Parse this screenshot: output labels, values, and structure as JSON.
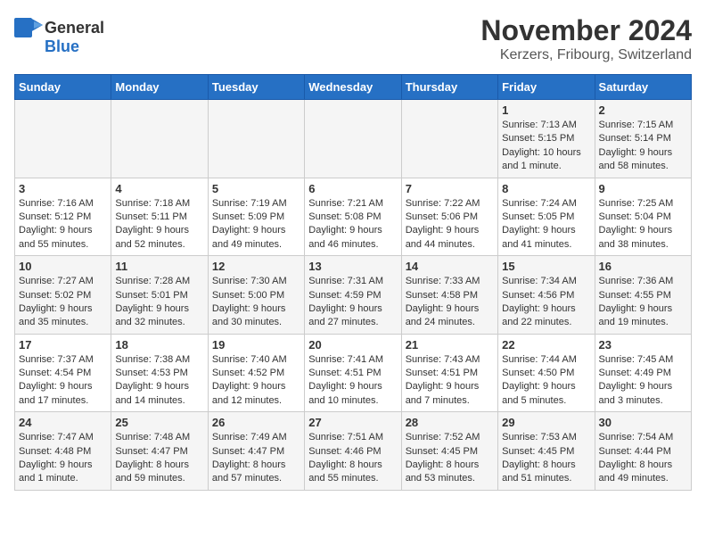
{
  "logo": {
    "general": "General",
    "blue": "Blue"
  },
  "header": {
    "month": "November 2024",
    "location": "Kerzers, Fribourg, Switzerland"
  },
  "weekdays": [
    "Sunday",
    "Monday",
    "Tuesday",
    "Wednesday",
    "Thursday",
    "Friday",
    "Saturday"
  ],
  "weeks": [
    [
      {
        "day": "",
        "info": ""
      },
      {
        "day": "",
        "info": ""
      },
      {
        "day": "",
        "info": ""
      },
      {
        "day": "",
        "info": ""
      },
      {
        "day": "",
        "info": ""
      },
      {
        "day": "1",
        "info": "Sunrise: 7:13 AM\nSunset: 5:15 PM\nDaylight: 10 hours and 1 minute."
      },
      {
        "day": "2",
        "info": "Sunrise: 7:15 AM\nSunset: 5:14 PM\nDaylight: 9 hours and 58 minutes."
      }
    ],
    [
      {
        "day": "3",
        "info": "Sunrise: 7:16 AM\nSunset: 5:12 PM\nDaylight: 9 hours and 55 minutes."
      },
      {
        "day": "4",
        "info": "Sunrise: 7:18 AM\nSunset: 5:11 PM\nDaylight: 9 hours and 52 minutes."
      },
      {
        "day": "5",
        "info": "Sunrise: 7:19 AM\nSunset: 5:09 PM\nDaylight: 9 hours and 49 minutes."
      },
      {
        "day": "6",
        "info": "Sunrise: 7:21 AM\nSunset: 5:08 PM\nDaylight: 9 hours and 46 minutes."
      },
      {
        "day": "7",
        "info": "Sunrise: 7:22 AM\nSunset: 5:06 PM\nDaylight: 9 hours and 44 minutes."
      },
      {
        "day": "8",
        "info": "Sunrise: 7:24 AM\nSunset: 5:05 PM\nDaylight: 9 hours and 41 minutes."
      },
      {
        "day": "9",
        "info": "Sunrise: 7:25 AM\nSunset: 5:04 PM\nDaylight: 9 hours and 38 minutes."
      }
    ],
    [
      {
        "day": "10",
        "info": "Sunrise: 7:27 AM\nSunset: 5:02 PM\nDaylight: 9 hours and 35 minutes."
      },
      {
        "day": "11",
        "info": "Sunrise: 7:28 AM\nSunset: 5:01 PM\nDaylight: 9 hours and 32 minutes."
      },
      {
        "day": "12",
        "info": "Sunrise: 7:30 AM\nSunset: 5:00 PM\nDaylight: 9 hours and 30 minutes."
      },
      {
        "day": "13",
        "info": "Sunrise: 7:31 AM\nSunset: 4:59 PM\nDaylight: 9 hours and 27 minutes."
      },
      {
        "day": "14",
        "info": "Sunrise: 7:33 AM\nSunset: 4:58 PM\nDaylight: 9 hours and 24 minutes."
      },
      {
        "day": "15",
        "info": "Sunrise: 7:34 AM\nSunset: 4:56 PM\nDaylight: 9 hours and 22 minutes."
      },
      {
        "day": "16",
        "info": "Sunrise: 7:36 AM\nSunset: 4:55 PM\nDaylight: 9 hours and 19 minutes."
      }
    ],
    [
      {
        "day": "17",
        "info": "Sunrise: 7:37 AM\nSunset: 4:54 PM\nDaylight: 9 hours and 17 minutes."
      },
      {
        "day": "18",
        "info": "Sunrise: 7:38 AM\nSunset: 4:53 PM\nDaylight: 9 hours and 14 minutes."
      },
      {
        "day": "19",
        "info": "Sunrise: 7:40 AM\nSunset: 4:52 PM\nDaylight: 9 hours and 12 minutes."
      },
      {
        "day": "20",
        "info": "Sunrise: 7:41 AM\nSunset: 4:51 PM\nDaylight: 9 hours and 10 minutes."
      },
      {
        "day": "21",
        "info": "Sunrise: 7:43 AM\nSunset: 4:51 PM\nDaylight: 9 hours and 7 minutes."
      },
      {
        "day": "22",
        "info": "Sunrise: 7:44 AM\nSunset: 4:50 PM\nDaylight: 9 hours and 5 minutes."
      },
      {
        "day": "23",
        "info": "Sunrise: 7:45 AM\nSunset: 4:49 PM\nDaylight: 9 hours and 3 minutes."
      }
    ],
    [
      {
        "day": "24",
        "info": "Sunrise: 7:47 AM\nSunset: 4:48 PM\nDaylight: 9 hours and 1 minute."
      },
      {
        "day": "25",
        "info": "Sunrise: 7:48 AM\nSunset: 4:47 PM\nDaylight: 8 hours and 59 minutes."
      },
      {
        "day": "26",
        "info": "Sunrise: 7:49 AM\nSunset: 4:47 PM\nDaylight: 8 hours and 57 minutes."
      },
      {
        "day": "27",
        "info": "Sunrise: 7:51 AM\nSunset: 4:46 PM\nDaylight: 8 hours and 55 minutes."
      },
      {
        "day": "28",
        "info": "Sunrise: 7:52 AM\nSunset: 4:45 PM\nDaylight: 8 hours and 53 minutes."
      },
      {
        "day": "29",
        "info": "Sunrise: 7:53 AM\nSunset: 4:45 PM\nDaylight: 8 hours and 51 minutes."
      },
      {
        "day": "30",
        "info": "Sunrise: 7:54 AM\nSunset: 4:44 PM\nDaylight: 8 hours and 49 minutes."
      }
    ]
  ]
}
